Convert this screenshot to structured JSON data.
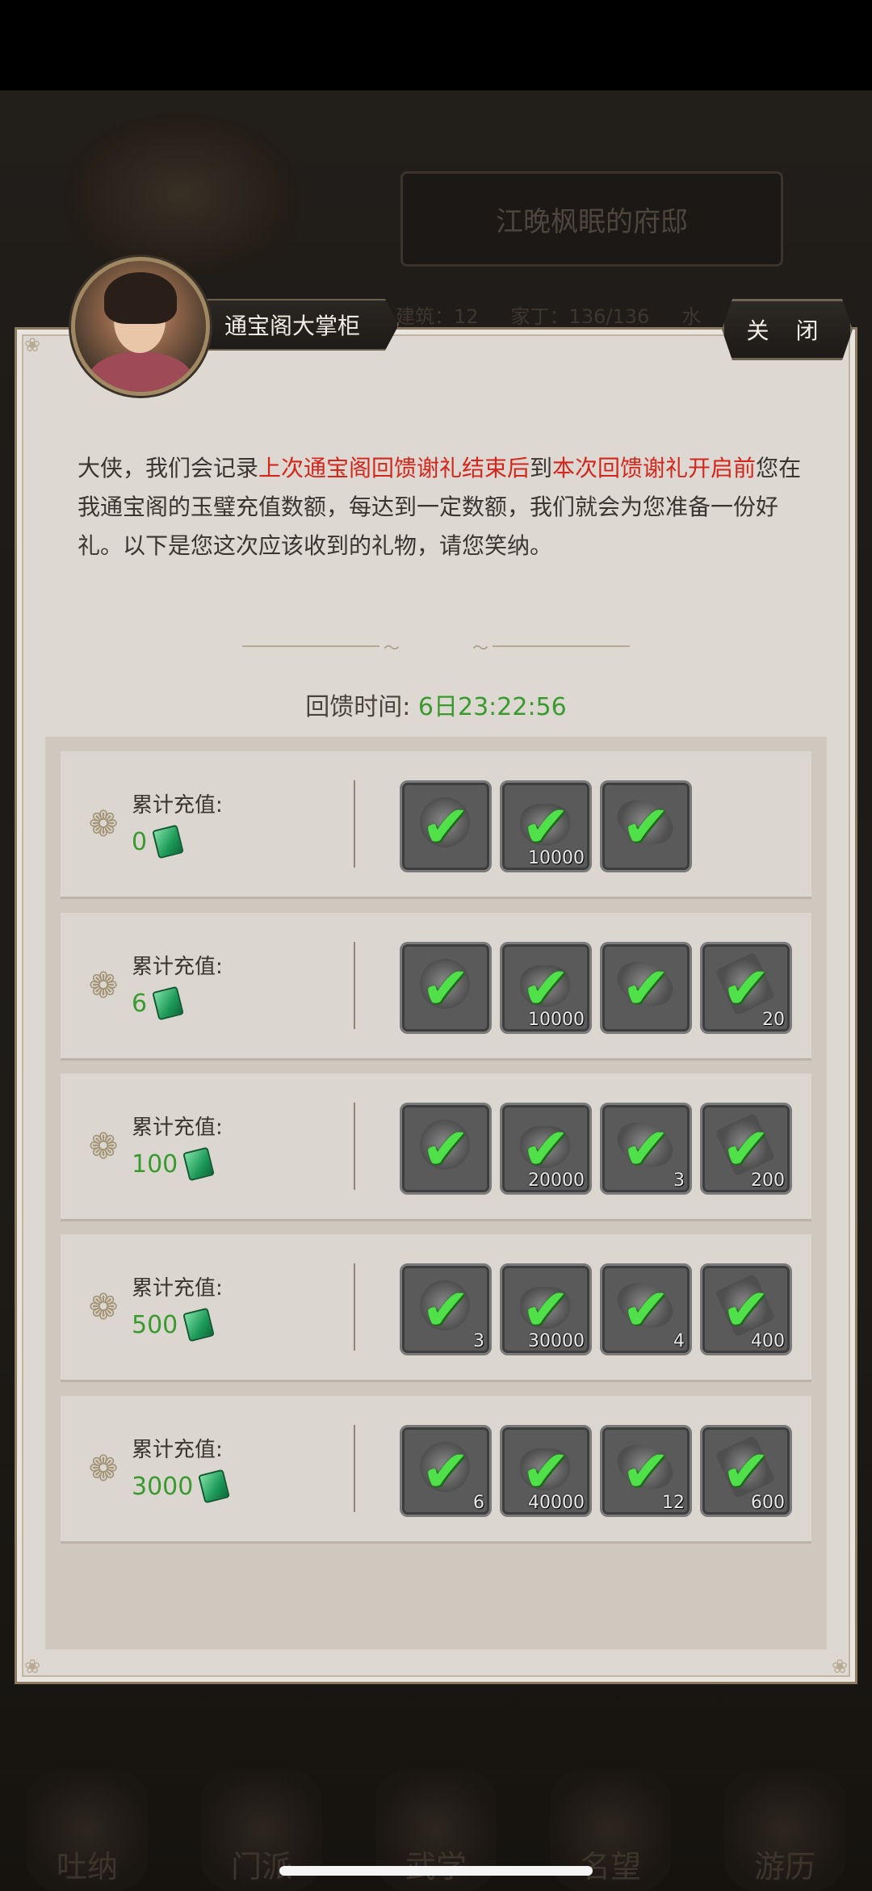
{
  "background": {
    "mansion_title": "江晚枫眠的府邸",
    "stats": [
      "建筑：12",
      "家丁：136/136",
      "水"
    ],
    "nav": [
      "吐纳",
      "门派",
      "武学",
      "名望",
      "游历"
    ]
  },
  "dialog": {
    "npc_name": "通宝阁大掌柜",
    "close_label": "关 闭",
    "description": {
      "p1": "大侠，我们会记录",
      "h1": "上次通宝阁回馈谢礼结束后",
      "p2": "到",
      "h2": "本次回馈谢礼开启前",
      "p3": "您在我通宝阁的玉璧充值数额，每达到一定数额，我们就会为您准备一份好礼。以下是您这次应该收到的礼物，请您笑纳。"
    },
    "feedback_label": "回馈时间:",
    "feedback_value": "6日23:22:56",
    "tiers": [
      {
        "label": "累计充值:",
        "amount": "0",
        "rewards": [
          {
            "icon": "coin-icon",
            "count": ""
          },
          {
            "icon": "ingot-icon",
            "count": "10000"
          },
          {
            "icon": "leaf-icon",
            "count": ""
          }
        ]
      },
      {
        "label": "累计充值:",
        "amount": "6",
        "rewards": [
          {
            "icon": "coin-icon",
            "count": ""
          },
          {
            "icon": "ingot-icon",
            "count": "10000"
          },
          {
            "icon": "leaf-icon",
            "count": ""
          },
          {
            "icon": "book-icon",
            "count": "20"
          }
        ]
      },
      {
        "label": "累计充值:",
        "amount": "100",
        "rewards": [
          {
            "icon": "coin-icon",
            "count": ""
          },
          {
            "icon": "ingot-icon",
            "count": "20000"
          },
          {
            "icon": "leaf-icon",
            "count": "3"
          },
          {
            "icon": "book-icon",
            "count": "200"
          }
        ]
      },
      {
        "label": "累计充值:",
        "amount": "500",
        "rewards": [
          {
            "icon": "coin-icon",
            "count": "3"
          },
          {
            "icon": "ingot-icon",
            "count": "30000"
          },
          {
            "icon": "leaf-icon",
            "count": "4"
          },
          {
            "icon": "book-icon",
            "count": "400"
          }
        ]
      },
      {
        "label": "累计充值:",
        "amount": "3000",
        "rewards": [
          {
            "icon": "coin-icon",
            "count": "6"
          },
          {
            "icon": "ingot-icon",
            "count": "40000"
          },
          {
            "icon": "leaf-icon",
            "count": "12"
          },
          {
            "icon": "book-icon",
            "count": "600"
          }
        ]
      }
    ]
  },
  "colors": {
    "highlight_red": "#d4261c",
    "value_green": "#3a9a2f",
    "check_green": "#4fe04a"
  }
}
